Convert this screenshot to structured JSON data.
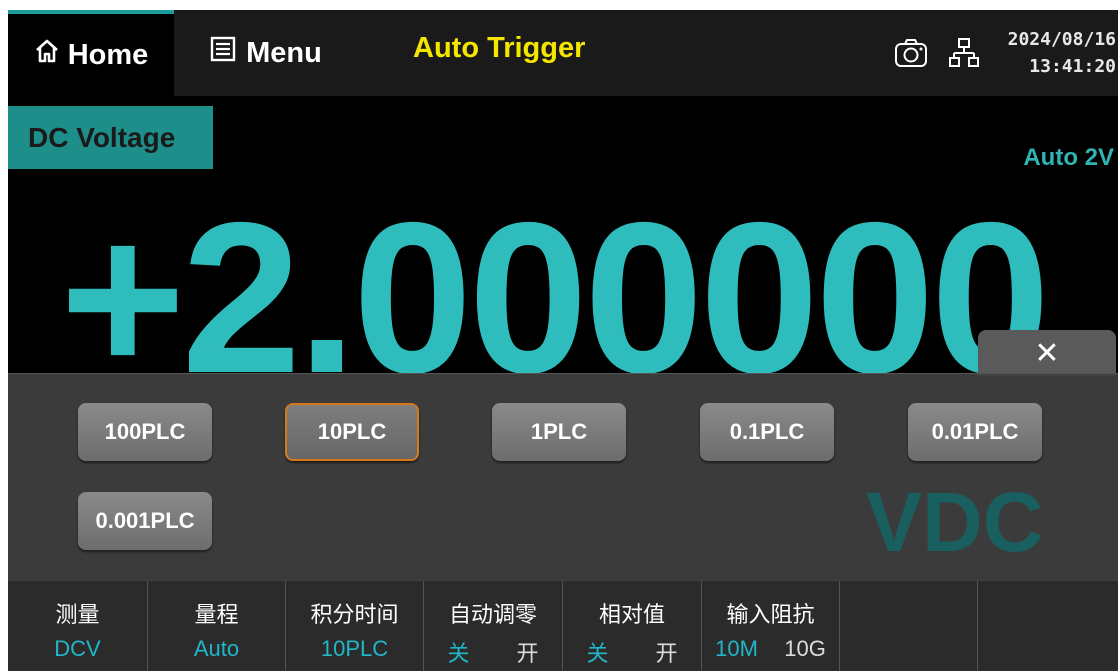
{
  "topbar": {
    "home_label": "Home",
    "menu_label": "Menu",
    "trigger_label": "Auto Trigger",
    "date": "2024/08/16",
    "time": "13:41:20"
  },
  "display": {
    "function": "DC Voltage",
    "range": "Auto 2V",
    "reading": "+2.000000",
    "unit": "VDC"
  },
  "popup": {
    "close_symbol": "✕",
    "options": [
      "100PLC",
      "10PLC",
      "1PLC",
      "0.1PLC",
      "0.01PLC",
      "0.001PLC"
    ],
    "selected": "10PLC"
  },
  "softkeys": [
    {
      "title": "测量",
      "value": "DCV"
    },
    {
      "title": "量程",
      "value": "Auto"
    },
    {
      "title": "积分时间",
      "value": "10PLC"
    },
    {
      "title": "自动调零",
      "options": [
        "关",
        "开"
      ]
    },
    {
      "title": "相对值",
      "options": [
        "关",
        "开"
      ]
    },
    {
      "title": "输入阻抗",
      "options": [
        "10M",
        "10G"
      ]
    }
  ],
  "colors": {
    "accent": "#1d8e8a",
    "reading": "#2fbcbc",
    "trigger": "#f5e600",
    "selected_border": "#d47a1c"
  }
}
